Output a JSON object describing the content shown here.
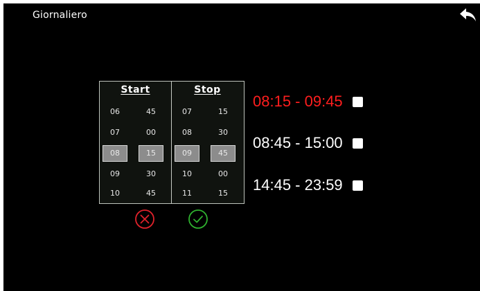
{
  "header": {
    "title": "Giornaliero",
    "back_icon": "back-arrow-icon"
  },
  "picker": {
    "start_label": "Start",
    "stop_label": "Stop",
    "start_hours": [
      "06",
      "07",
      "08",
      "09",
      "10"
    ],
    "start_minutes": [
      "45",
      "00",
      "15",
      "30",
      "45"
    ],
    "stop_hours": [
      "07",
      "08",
      "09",
      "10",
      "11"
    ],
    "stop_minutes": [
      "15",
      "30",
      "45",
      "00",
      "15"
    ],
    "selected_start": {
      "hour": "08",
      "minute": "15"
    },
    "selected_stop": {
      "hour": "09",
      "minute": "45"
    },
    "cancel_icon": "cancel-circle-icon",
    "confirm_icon": "confirm-circle-icon",
    "cancel_color": "#e0222b",
    "confirm_color": "#2fb12f"
  },
  "slots": [
    {
      "label": "08:15 - 09:45",
      "active": true
    },
    {
      "label": "08:45 - 15:00",
      "active": false
    },
    {
      "label": "14:45 - 23:59",
      "active": false
    }
  ],
  "colors": {
    "background": "#000000",
    "active_slot": "#ff1e1e",
    "text": "#ffffff",
    "selected_cell": "#8c8c8c"
  }
}
